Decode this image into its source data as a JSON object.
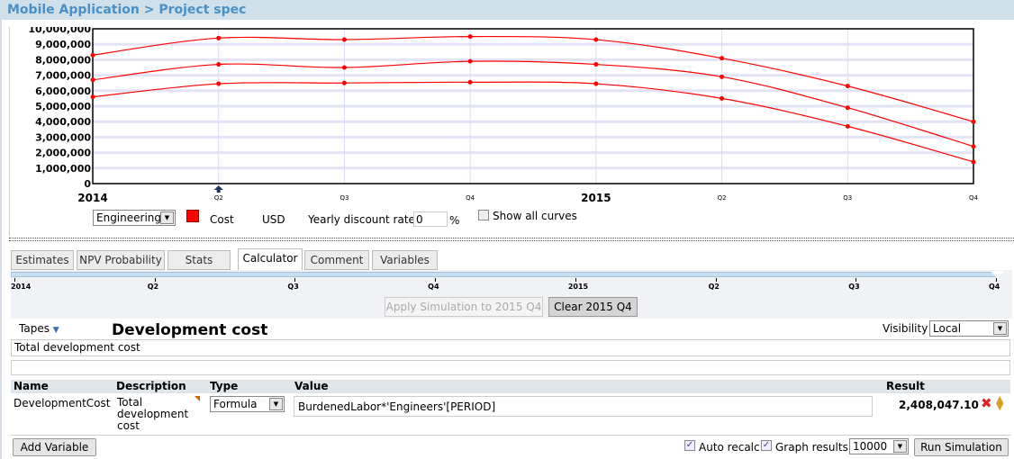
{
  "breadcrumb": {
    "text": "Mobile Application > Project spec"
  },
  "chart_data": {
    "type": "line",
    "x": [
      "2014",
      "Q2",
      "Q3",
      "Q4",
      "2015",
      "Q2",
      "Q3",
      "Q4"
    ],
    "ylim": [
      0,
      10000000
    ],
    "yticks": [
      "0",
      "1,000,000",
      "2,000,000",
      "3,000,000",
      "4,000,000",
      "5,000,000",
      "6,000,000",
      "7,000,000",
      "8,000,000",
      "9,000,000",
      "10,000,000"
    ],
    "grid": true,
    "color": "#ff0000",
    "series": [
      {
        "values": [
          8300000,
          9400000,
          9300000,
          9500000,
          9300000,
          8100000,
          6300000,
          4000000
        ]
      },
      {
        "values": [
          6700000,
          7700000,
          7500000,
          7900000,
          7700000,
          6900000,
          4900000,
          2400000
        ]
      },
      {
        "values": [
          5600000,
          6450000,
          6500000,
          6550000,
          6450000,
          5500000,
          3700000,
          1400000
        ]
      }
    ]
  },
  "controls": {
    "category": "Engineering",
    "legend_label": "Cost",
    "currency": "USD",
    "discount_label": "Yearly discount rate",
    "discount_value": "0",
    "percent": "%",
    "show_all_curves": "Show all curves",
    "show_all_checked": false
  },
  "tabs": [
    "Estimates",
    "NPV Probability",
    "Stats",
    "Calculator",
    "Comment",
    "Variables"
  ],
  "active_tab": "Calculator",
  "timeline": [
    "2014",
    "Q2",
    "Q3",
    "Q4",
    "2015",
    "Q2",
    "Q3",
    "Q4"
  ],
  "calc": {
    "apply_btn": "Apply Simulation to 2015 Q4",
    "clear_btn": "Clear 2015 Q4",
    "tapes": "Tapes",
    "title": "Development cost",
    "visibility_label": "Visibility",
    "visibility": "Local",
    "description": "Total development cost",
    "notes": "",
    "columns": {
      "name": "Name",
      "description": "Description",
      "type": "Type",
      "value": "Value",
      "result": "Result"
    },
    "row": {
      "name": "DevelopmentCost",
      "description": "Total development cost",
      "type": "Formula",
      "value": "BurdenedLabor*'Engineers'[PERIOD]",
      "result": "2,408,047.10"
    },
    "add_variable": "Add Variable",
    "auto_recalc": "Auto recalc",
    "graph_results": "Graph results",
    "iterations": "10000",
    "run": "Run Simulation"
  }
}
